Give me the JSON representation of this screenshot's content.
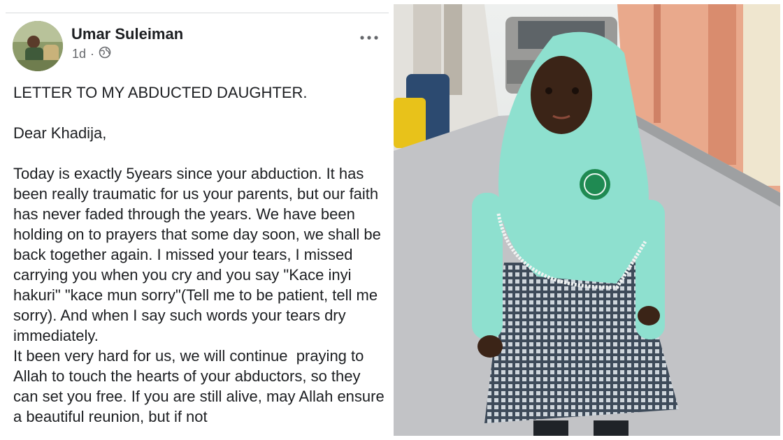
{
  "post": {
    "author": "Umar Suleiman",
    "time": "1d",
    "separator": "·",
    "audience_icon": "globe-icon",
    "more_icon": "more-options-icon",
    "title": "LETTER TO MY ABDUCTED DAUGHTER.",
    "greeting": "Dear Khadija,",
    "paragraph1": "Today is exactly 5years since your abduction. It has been really traumatic for us your parents, but our faith has never faded through the years. We have been holding on to prayers that some day soon, we shall be back together again. I missed your tears, I missed carrying you when you cry and you say \"Kace inyi hakuri\" \"kace mun sorry\"(Tell me to be patient, tell me sorry). And when I say such words your tears dry immediately.",
    "paragraph2": "It been very hard for us, we will continue  praying to Allah to touch the hearts of your abductors, so they can set you free. If you are still alive, may Allah ensure a beautiful reunion, but if not"
  },
  "colors": {
    "hijab": "#8ee0cf",
    "skirt": "#4a5868",
    "wall": "#e9a98c",
    "ground": "#c2c3c6"
  }
}
